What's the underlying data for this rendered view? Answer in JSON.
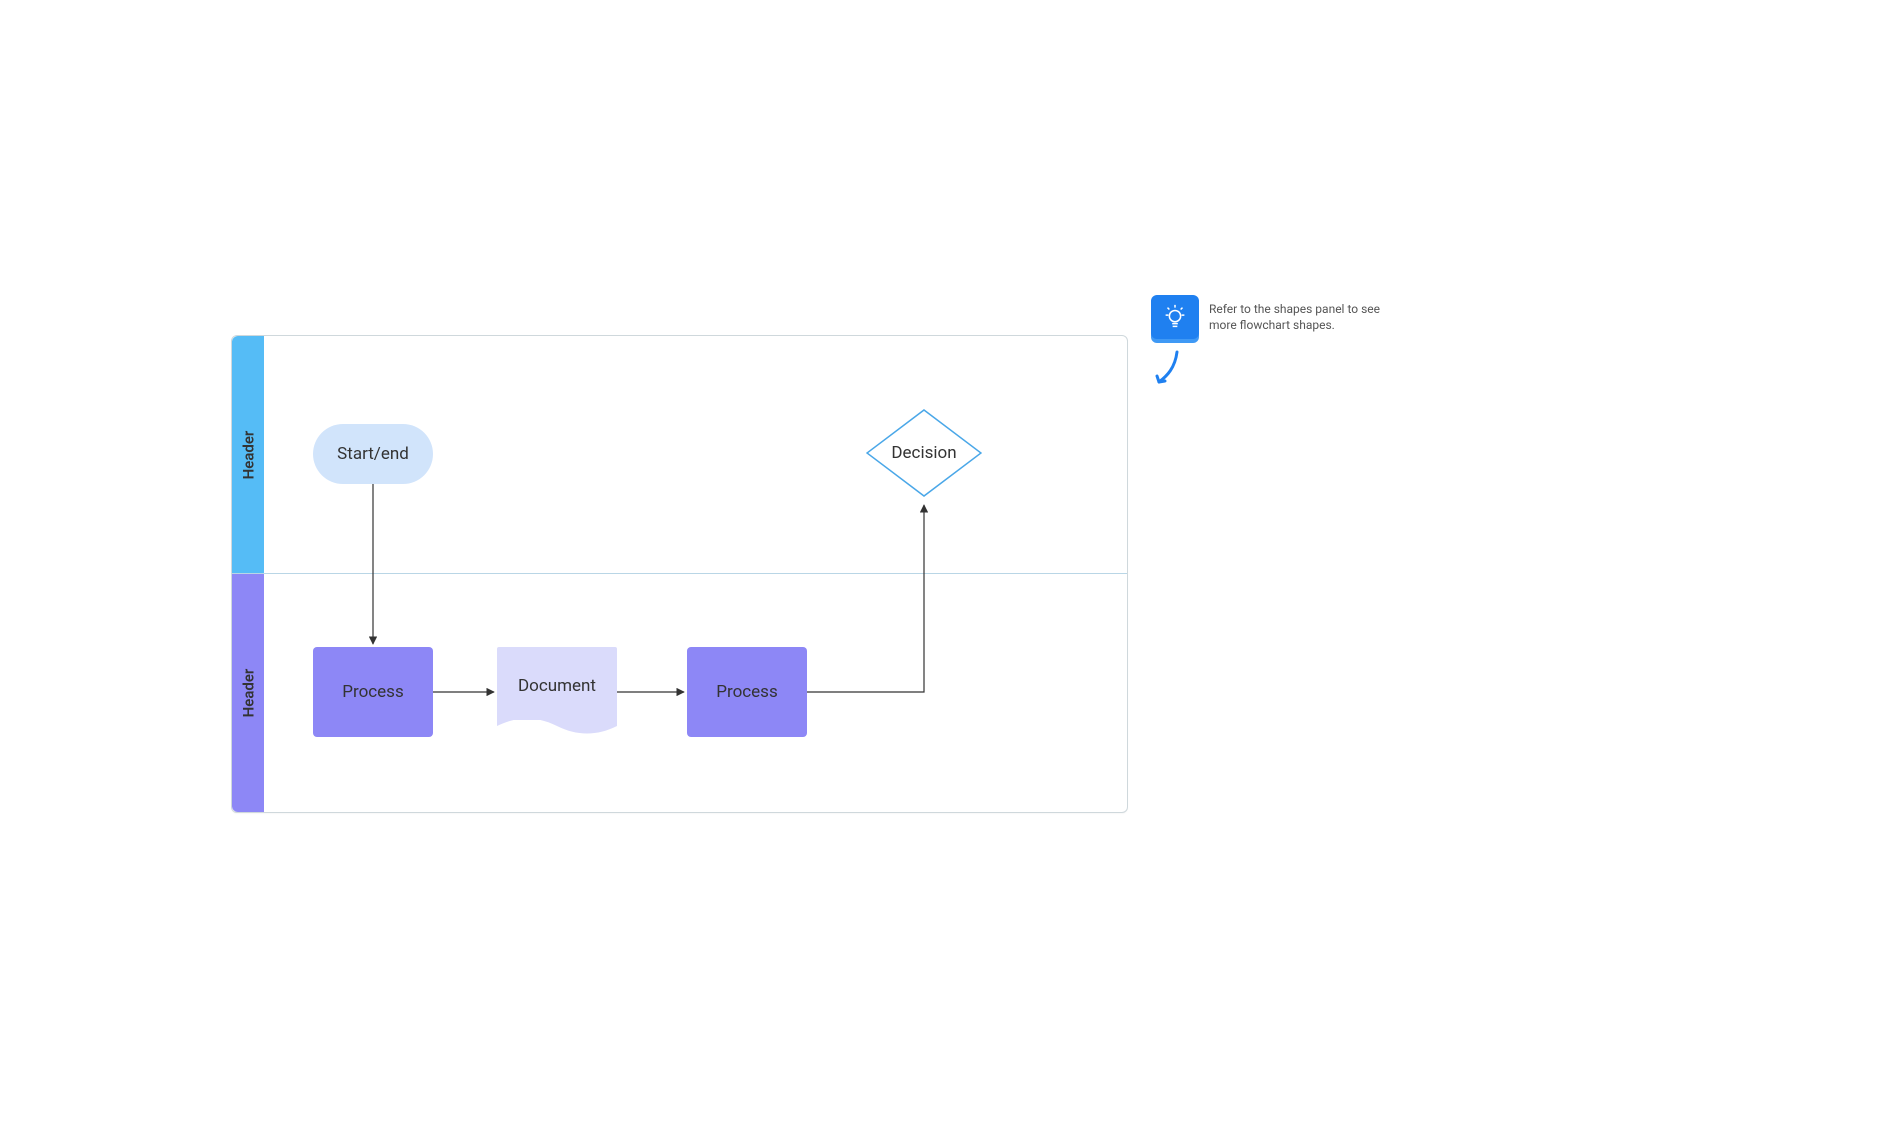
{
  "swimlanes": {
    "lane1": {
      "header": "Header"
    },
    "lane2": {
      "header": "Header"
    }
  },
  "shapes": {
    "startend": {
      "label": "Start/end"
    },
    "process1": {
      "label": "Process"
    },
    "document": {
      "label": "Document"
    },
    "process2": {
      "label": "Process"
    },
    "decision": {
      "label": "Decision"
    }
  },
  "hint": {
    "text": "Refer to the shapes panel to see more flowchart shapes."
  },
  "colors": {
    "lane_top_header": "#55bcf6",
    "lane_bot_header": "#8d87f6",
    "terminator_fill": "#d1e4fb",
    "process_fill": "#8d87f6",
    "document_fill": "#dadbfb",
    "decision_stroke": "#4aa7e8",
    "hint_blue": "#1f80f0"
  }
}
